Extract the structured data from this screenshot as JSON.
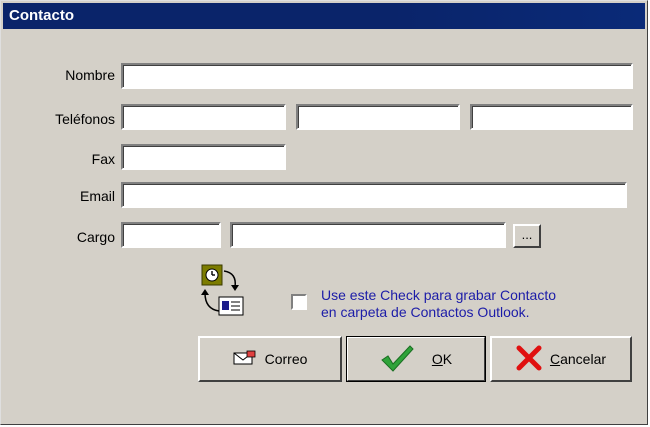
{
  "window": {
    "title": "Contacto"
  },
  "form": {
    "nombre": {
      "label": "Nombre",
      "value": ""
    },
    "telefonos": {
      "label": "Teléfonos",
      "values": [
        "",
        "",
        ""
      ]
    },
    "fax": {
      "label": "Fax",
      "value": ""
    },
    "email": {
      "label": "Email",
      "value": ""
    },
    "cargo": {
      "label": "Cargo",
      "values": [
        "",
        ""
      ],
      "browse_label": "..."
    }
  },
  "outlook": {
    "checked": false,
    "text_line1": "Use este Check para grabar Contacto",
    "text_line2": "en carpeta de Contactos Outlook."
  },
  "buttons": {
    "correo": "Correo",
    "ok_accel": "O",
    "ok_rest": "K",
    "cancelar_accel": "C",
    "cancelar_rest": "ancelar"
  },
  "colors": {
    "titlebar": "#0a246a",
    "dialog_bg": "#d4d0c8",
    "check_text": "#1c1ca8",
    "ok_check": "#2fa33a",
    "cancel_x": "#e01010"
  },
  "icons": {
    "outlook": "outlook-contact-sync-icon",
    "correo": "mail-envelope-icon",
    "ok": "checkmark-icon",
    "cancel": "red-x-icon"
  }
}
